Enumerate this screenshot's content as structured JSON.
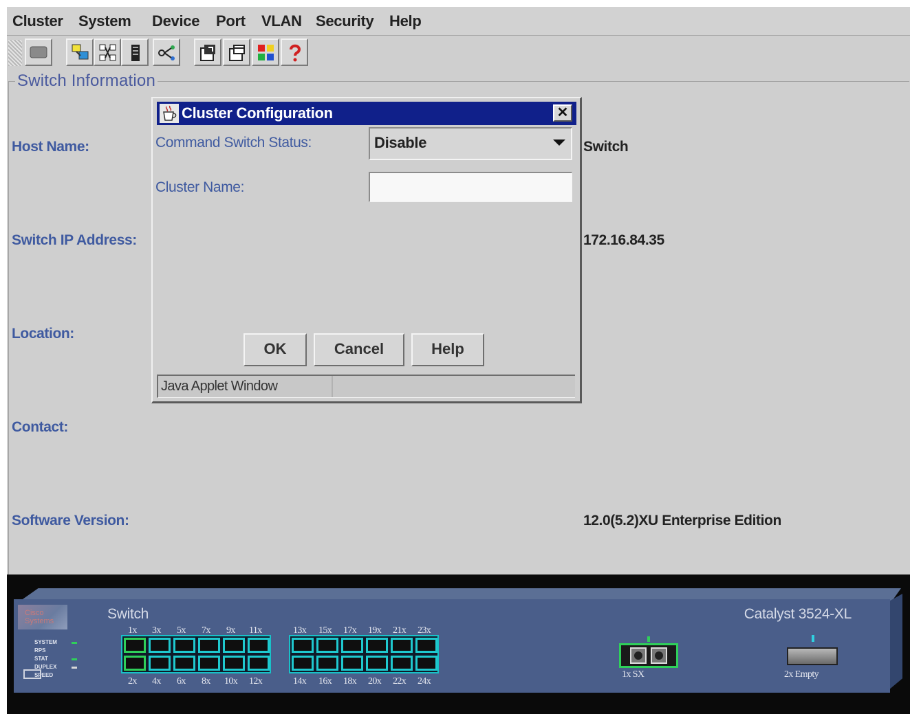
{
  "menubar": {
    "items": [
      "Cluster",
      "System",
      "Device",
      "Port",
      "VLAN",
      "Security",
      "Help"
    ]
  },
  "toolbar": {
    "buttons": [
      "panel-icon",
      "host-icon",
      "topology-icon",
      "device-icon",
      "link-icon",
      "new-window-icon",
      "open-window-icon",
      "color-legend-icon",
      "help-icon"
    ]
  },
  "switch_info": {
    "group_title": "Switch Information",
    "host_name_label": "Host Name:",
    "host_name_value": "Switch",
    "ip_label": "Switch IP Address:",
    "ip_value": "172.16.84.35",
    "location_label": "Location:",
    "contact_label": "Contact:",
    "software_label": "Software Version:",
    "software_value": "12.0(5.2)XU Enterprise Edition"
  },
  "dialog": {
    "title": "Cluster Configuration",
    "close_label": "✕",
    "status_label": "Command Switch Status:",
    "status_value": "Disable",
    "cluster_name_label": "Cluster Name:",
    "cluster_name_value": "",
    "ok_label": "OK",
    "cancel_label": "Cancel",
    "help_label": "Help",
    "footer": "Java Applet Window"
  },
  "device": {
    "name": "Switch",
    "model": "Catalyst 3524-XL",
    "logo": "Cisco Systems",
    "leds": [
      "SYSTEM",
      "RPS",
      "STAT",
      "DUPLEX",
      "SPEED"
    ],
    "ports_top_bank1": [
      "1x",
      "3x",
      "5x",
      "7x",
      "9x",
      "11x"
    ],
    "ports_bottom_bank1": [
      "2x",
      "4x",
      "6x",
      "8x",
      "10x",
      "12x"
    ],
    "ports_top_bank2": [
      "13x",
      "15x",
      "17x",
      "19x",
      "21x",
      "23x"
    ],
    "ports_bottom_bank2": [
      "14x",
      "16x",
      "18x",
      "20x",
      "22x",
      "24x"
    ],
    "gbic1_label": "1x SX",
    "gbic2_label": "2x Empty"
  },
  "colors": {
    "title_bar": "#10208a",
    "label_blue": "#3f5aa0",
    "port_cyan": "#1fc9cf",
    "active_green": "#2fd05a",
    "chassis": "#4a5e8a"
  }
}
